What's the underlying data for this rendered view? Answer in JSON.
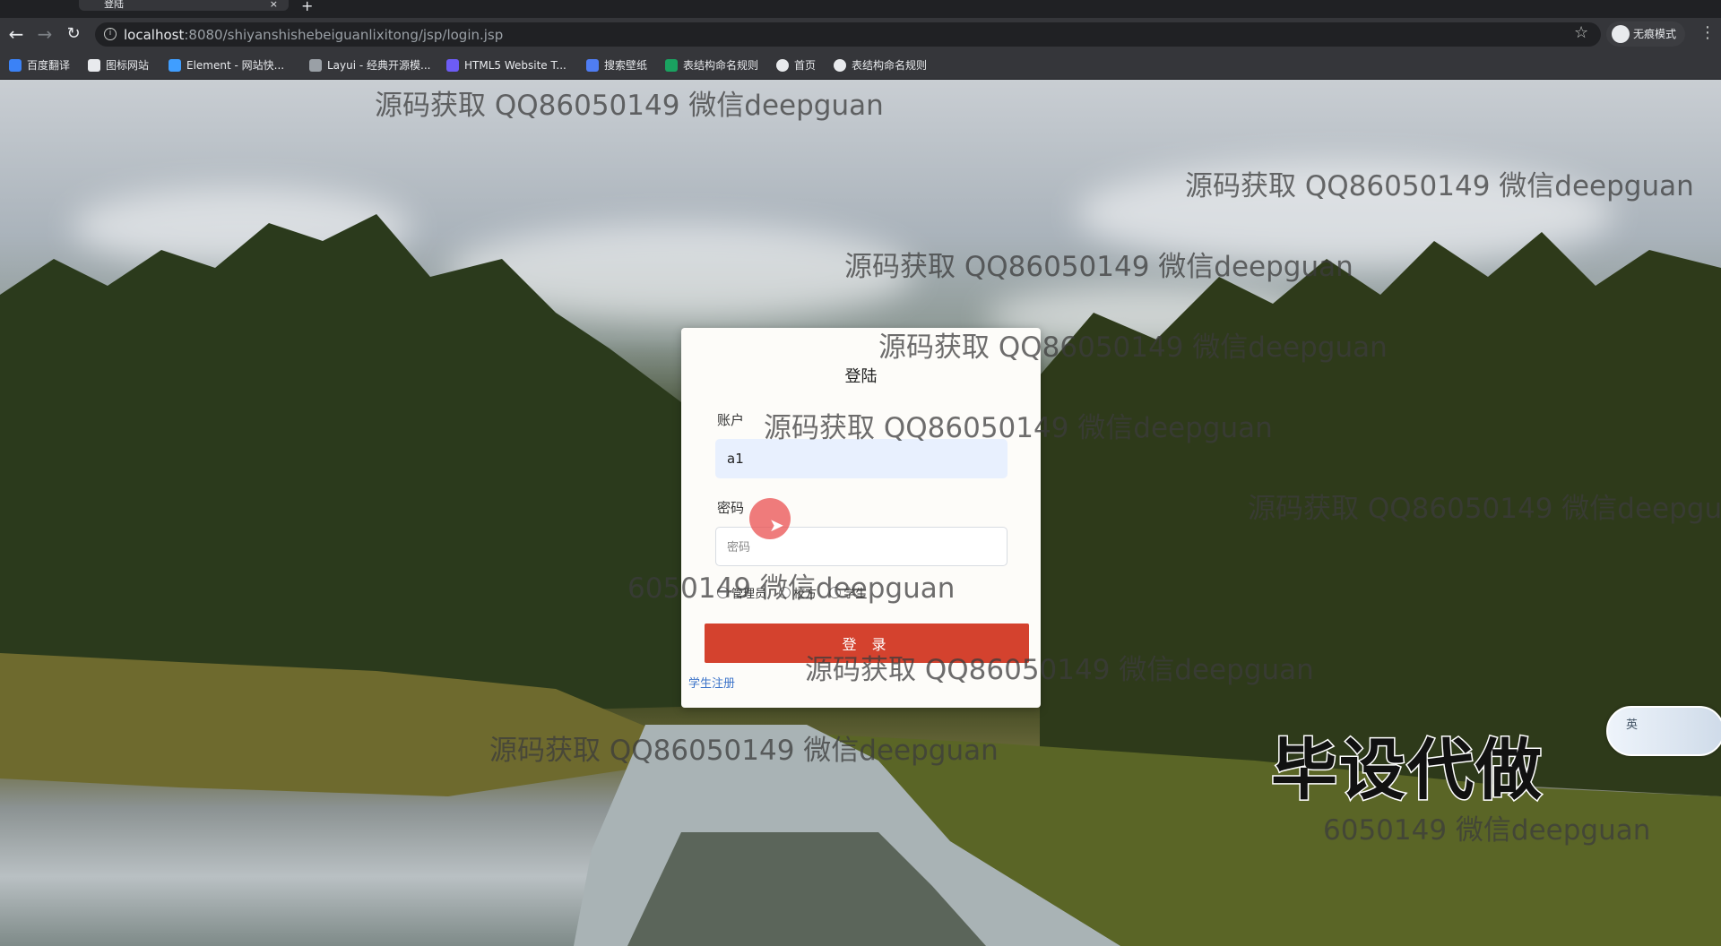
{
  "browser": {
    "tab_title": "登陆",
    "tab_close": "×",
    "new_tab": "+",
    "url_host": "localhost",
    "url_rest": ":8080/shiyanshishebeiguanlixitong/jsp/login.jsp",
    "incognito_label": "无痕模式",
    "bookmarks": [
      {
        "label": "百度翻译",
        "color": "#3b82f6"
      },
      {
        "label": "图标网站",
        "color": "#e8eaed"
      },
      {
        "label": "Element - 网站快...",
        "color": "#409eff"
      },
      {
        "label": "Layui - 经典开源模...",
        "color": "#9aa0a6"
      },
      {
        "label": "HTML5 Website T...",
        "color": "#6d5cf5"
      },
      {
        "label": "搜索壁纸",
        "color": "#4f7df3"
      },
      {
        "label": "表结构命名规则",
        "color": "#1aa260"
      },
      {
        "label": "首页",
        "color": "#e8eaed"
      },
      {
        "label": "表结构命名规则",
        "color": "#e8eaed"
      }
    ]
  },
  "login": {
    "title": "登陆",
    "account_label": "账户",
    "account_value": "a1",
    "password_label": "密码",
    "password_placeholder": "密码",
    "roles": [
      "管理员",
      "校方",
      "学生"
    ],
    "login_button": "登 录",
    "register_link": "学生注册"
  },
  "overlay": {
    "watermark_text": "源码获取 QQ86050149 微信deepguan",
    "watermark_fragment": "6050149 微信deepguan",
    "promo_text": "毕设代做",
    "widget_label": "英"
  }
}
